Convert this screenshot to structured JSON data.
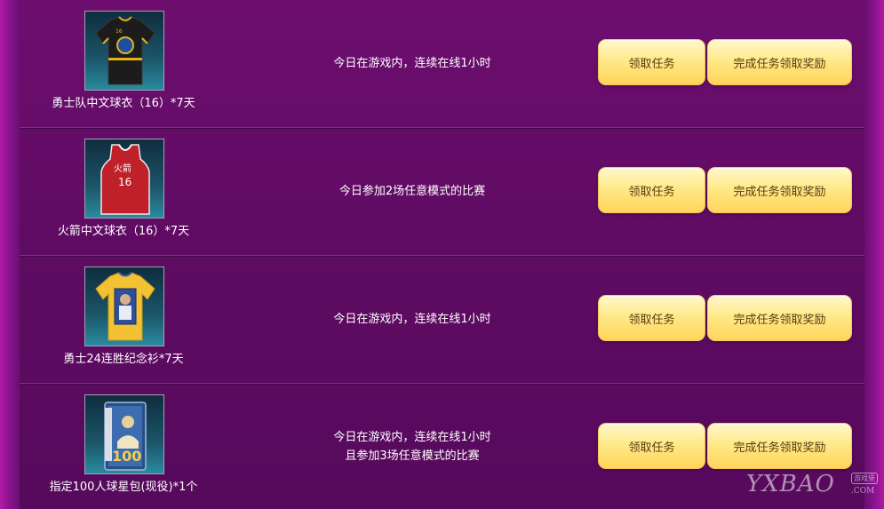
{
  "tasks": [
    {
      "reward_name": "勇士队中文球衣（16）*7天",
      "reward_icon": "warriors-black-jersey-icon",
      "task_lines": [
        "今日在游戏内，连续在线1小时"
      ],
      "claim_label": "领取任务",
      "complete_label": "完成任务领取奖励"
    },
    {
      "reward_name": "火箭中文球衣（16）*7天",
      "reward_icon": "rockets-red-jersey-icon",
      "task_lines": [
        "今日参加2场任意模式的比赛"
      ],
      "claim_label": "领取任务",
      "complete_label": "完成任务领取奖励"
    },
    {
      "reward_name": "勇士24连胜纪念衫*7天",
      "reward_icon": "warriors-commemorative-shirt-icon",
      "task_lines": [
        "今日在游戏内，连续在线1小时"
      ],
      "claim_label": "领取任务",
      "complete_label": "完成任务领取奖励"
    },
    {
      "reward_name": "指定100人球星包(现役)*1个",
      "reward_icon": "star-player-pack-icon",
      "task_lines": [
        "今日在游戏内，连续在线1小时",
        "且参加3场任意模式的比赛"
      ],
      "claim_label": "领取任务",
      "complete_label": "完成任务领取奖励"
    }
  ],
  "jersey_text": {
    "rockets": "火箭",
    "rockets_number": "16",
    "warriors_number": "16",
    "pack_number": "100"
  },
  "watermark": {
    "main": "YXBAO",
    "sub": "游戏堡",
    "domain": ".COM"
  },
  "colors": {
    "background": "#6d0e6f",
    "button_top": "#fff8cc",
    "button_bottom": "#ffd45a",
    "text": "#ffffff"
  }
}
